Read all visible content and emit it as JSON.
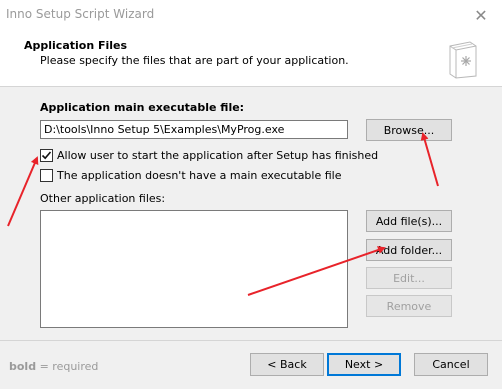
{
  "window": {
    "title": "Inno Setup Script Wizard",
    "close_glyph": "✕"
  },
  "header": {
    "title": "Application Files",
    "subtitle": "Please specify the files that are part of your application."
  },
  "main": {
    "exe_label": "Application main executable file:",
    "exe_value": "D:\\tools\\Inno Setup 5\\Examples\\MyProg.exe",
    "browse_label": "Browse...",
    "allow_user_label": "Allow user to start the application after Setup has finished",
    "allow_user_checked": true,
    "no_exe_label": "The application doesn't have a main executable file",
    "no_exe_checked": false,
    "other_files_label": "Other application files:",
    "add_files_label": "Add file(s)...",
    "add_folder_label": "Add folder...",
    "edit_label": "Edit...",
    "remove_label": "Remove"
  },
  "footer": {
    "hint_bold": "bold",
    "hint_rest": " = required",
    "back_label": "< Back",
    "next_label": "Next >",
    "cancel_label": "Cancel"
  },
  "colors": {
    "annotation_arrow": "#e8232a",
    "default_button_border": "#0078d7"
  }
}
